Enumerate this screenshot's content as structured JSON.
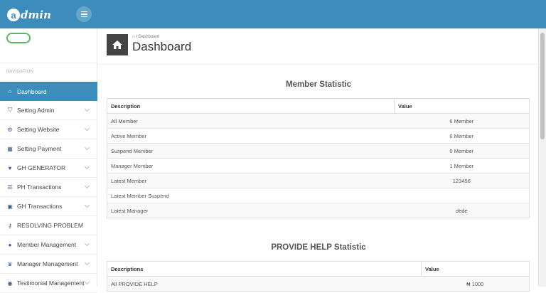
{
  "brand": {
    "letter": "a",
    "name": "dmin"
  },
  "sidebar": {
    "nav_header": "NAVIGATION",
    "items": [
      {
        "label": "Dashboard",
        "icon": "home-icon",
        "glyph": "⌂"
      },
      {
        "label": "Setting Admin",
        "icon": "shield-icon",
        "glyph": "⛉"
      },
      {
        "label": "Setting Website",
        "icon": "gear-icon",
        "glyph": "⚙"
      },
      {
        "label": "Setting Payment",
        "icon": "bank-icon",
        "glyph": "▦"
      },
      {
        "label": "GH GENERATOR",
        "icon": "heart-icon",
        "glyph": "♥"
      },
      {
        "label": "PH Transactions",
        "icon": "list-icon",
        "glyph": "☰"
      },
      {
        "label": "GH Transactions",
        "icon": "money-icon",
        "glyph": "▣"
      },
      {
        "label": "RESOLVING PROBLEM",
        "icon": "key-icon",
        "glyph": "⚷"
      },
      {
        "label": "Member Management",
        "icon": "user-icon",
        "glyph": "●"
      },
      {
        "label": "Manager Management",
        "icon": "trophy-icon",
        "glyph": "♛"
      },
      {
        "label": "Testimonial Management",
        "icon": "comments-icon",
        "glyph": "◉"
      }
    ]
  },
  "header": {
    "breadcrumb": "Dashboard",
    "title": "Dashboard"
  },
  "member_stats": {
    "title": "Member Statistic",
    "col1": "Description",
    "col2": "Value",
    "rows": [
      {
        "desc": "All Member",
        "value": "6 Member"
      },
      {
        "desc": "Active Member",
        "value": "6 Member"
      },
      {
        "desc": "Suspend Member",
        "value": "0 Member"
      },
      {
        "desc": "Manager Member",
        "value": "1 Member"
      },
      {
        "desc": "Latest Member",
        "value": "123456"
      },
      {
        "desc": "Latest Member Suspend",
        "value": ""
      },
      {
        "desc": "Latest Manager",
        "value": "dede"
      }
    ]
  },
  "ph_stats": {
    "title": "PROVIDE HELP Statistic",
    "col1": "Descriptions",
    "col2": "Value",
    "rows": [
      {
        "desc": "All PROVIDE HELP",
        "value": "₦ 1000"
      }
    ]
  },
  "colors": {
    "primary": "#3c8dbc",
    "accent_green": "#5cb85c"
  }
}
